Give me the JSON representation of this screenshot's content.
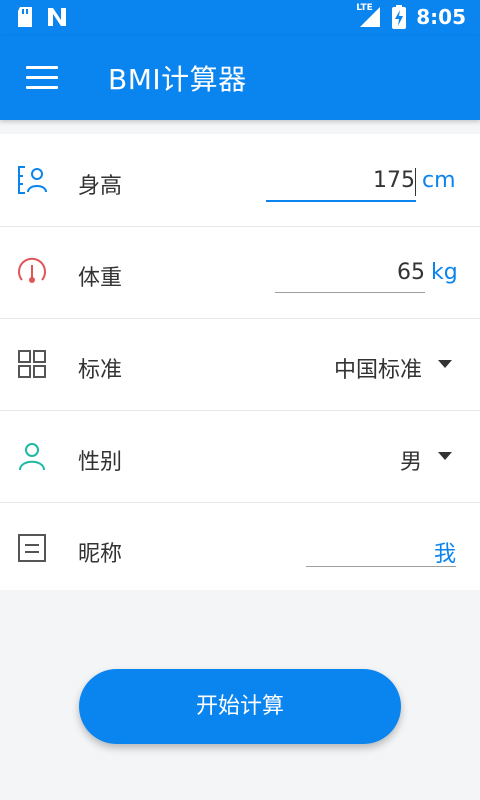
{
  "status_bar": {
    "time": "8:05",
    "network": "LTE",
    "icons": [
      "sd-card-icon",
      "n-notification-icon",
      "signal-icon",
      "battery-charging-icon"
    ]
  },
  "app_bar": {
    "title": "BMI计算器",
    "menu_icon": "menu-icon"
  },
  "form": {
    "height": {
      "label": "身高",
      "value": "175",
      "unit": "cm",
      "icon": "person-height-icon"
    },
    "weight": {
      "label": "体重",
      "value": "65",
      "unit": "kg",
      "icon": "scale-gauge-icon"
    },
    "standard": {
      "label": "标准",
      "selected": "中国标准",
      "icon": "grid-icon"
    },
    "gender": {
      "label": "性别",
      "selected": "男",
      "icon": "person-icon"
    },
    "nickname": {
      "label": "昵称",
      "value": "我",
      "icon": "note-icon"
    }
  },
  "actions": {
    "start_label": "开始计算"
  },
  "colors": {
    "primary": "#0a84ee",
    "accent_red": "#e25555",
    "teal": "#1eb8a6"
  }
}
